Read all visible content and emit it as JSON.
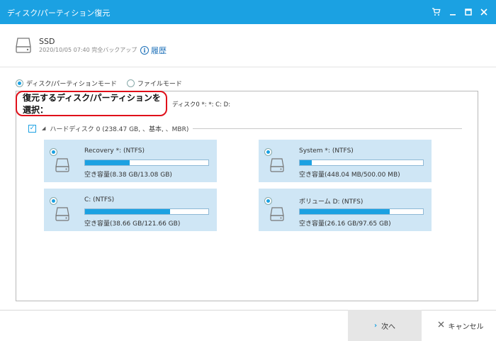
{
  "window": {
    "title": "ディスク/パーティション復元"
  },
  "source": {
    "drive_name": "SSD",
    "backup_info": "2020/10/05 07:40 完全バックアップ",
    "history_label": "履歴"
  },
  "modes": [
    {
      "label": "ディスク/パーティションモード",
      "selected": true
    },
    {
      "label": "ファイルモード",
      "selected": false
    }
  ],
  "selection": {
    "label": "復元するディスク/パーティションを選択：",
    "value": "ディスク0 *: *: C: D:"
  },
  "disk": {
    "label": "ハードディスク 0 (238.47 GB, 、基本, 、MBR)",
    "checked": true
  },
  "partitions": [
    {
      "name": "Recovery *: (NTFS)",
      "space": "空き容量(8.38 GB/13.08 GB)",
      "used_fraction": 0.36
    },
    {
      "name": "System *: (NTFS)",
      "space": "空き容量(448.04 MB/500.00 MB)",
      "used_fraction": 0.1
    },
    {
      "name": "C: (NTFS)",
      "space": "空き容量(38.66 GB/121.66 GB)",
      "used_fraction": 0.69
    },
    {
      "name": "ボリューム D: (NTFS)",
      "space": "空き容量(26.16 GB/97.65 GB)",
      "used_fraction": 0.73
    }
  ],
  "footer": {
    "next_label": "次へ",
    "cancel_label": "キャンセル"
  },
  "colors": {
    "titlebar": "#1ba1e2",
    "accent": "#1ba1e2",
    "highlight_border": "#e0101a",
    "partition_bg": "#cfe6f5"
  }
}
